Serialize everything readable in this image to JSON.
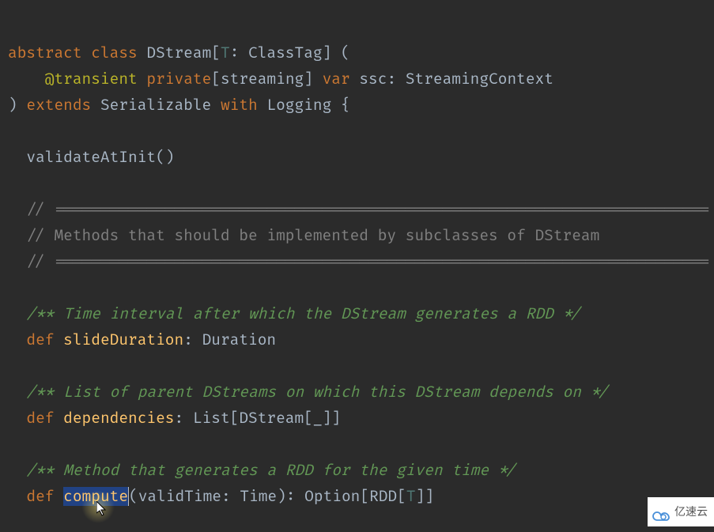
{
  "code": {
    "l1": {
      "t1": "abstract",
      "t2": " ",
      "t3": "class",
      "t4": " DStream[",
      "t5": "T",
      "t6": ": ClassTag] ("
    },
    "l2": {
      "t1": "    ",
      "t2": "@transient",
      "t3": " ",
      "t4": "private",
      "t5": "[streaming] ",
      "t6": "var",
      "t7": " ssc: StreamingContext"
    },
    "l3": {
      "t1": ") ",
      "t2": "extends",
      "t3": " Serializable ",
      "t4": "with",
      "t5": " Logging {"
    },
    "l4": {
      "t1": ""
    },
    "l5": {
      "t1": "  validateAtInit()"
    },
    "l6": {
      "t1": ""
    },
    "l7": {
      "t1": "  // ======================================================================="
    },
    "l8": {
      "t1": "  // Methods that should be implemented by subclasses of DStream"
    },
    "l9": {
      "t1": "  // ======================================================================="
    },
    "l10": {
      "t1": ""
    },
    "l11": {
      "t1": "  /** Time interval after which the DStream generates a RDD */"
    },
    "l12": {
      "t1": "  ",
      "t2": "def",
      "t3": " ",
      "t4": "slideDuration",
      "t5": ": Duration"
    },
    "l13": {
      "t1": ""
    },
    "l14": {
      "t1": "  /** List of parent DStreams on which this DStream depends on */"
    },
    "l15": {
      "t1": "  ",
      "t2": "def",
      "t3": " ",
      "t4": "dependencies",
      "t5": ": List[DStream[_]]"
    },
    "l16": {
      "t1": ""
    },
    "l17": {
      "t1": "  /** Method that generates a RDD for the given time */"
    },
    "l18": {
      "t1": "  ",
      "t2": "def",
      "t3": " ",
      "t4": "compute",
      "t5": "(validTime: Time): Option[RDD[",
      "t6": "T",
      "t7": "]]"
    }
  },
  "watermark": {
    "text": "亿速云"
  }
}
